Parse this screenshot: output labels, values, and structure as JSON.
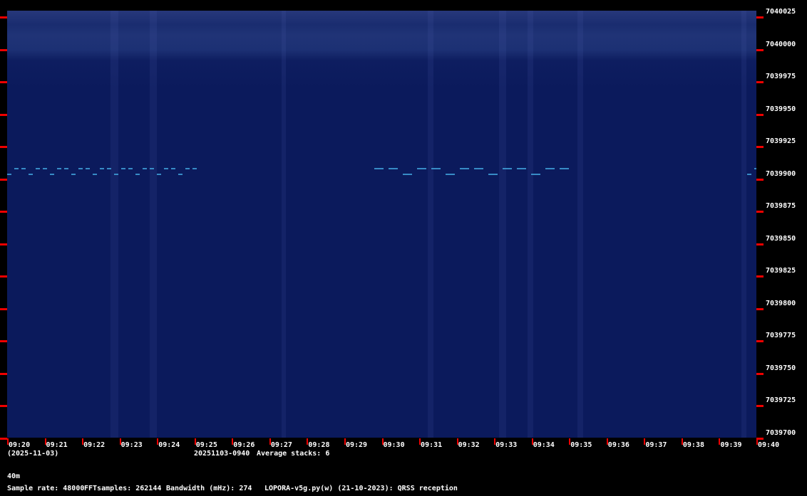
{
  "y_axis": {
    "labels": [
      "7040025",
      "7040000",
      "7039975",
      "7039950",
      "7039925",
      "7039900",
      "7039875",
      "7039850",
      "7039825",
      "7039800",
      "7039775",
      "7039750",
      "7039725",
      "7039700"
    ]
  },
  "x_axis": {
    "labels": [
      "09:20",
      "09:21",
      "09:22",
      "09:23",
      "09:24",
      "09:25",
      "09:26",
      "09:27",
      "09:28",
      "09:29",
      "09:30",
      "09:31",
      "09:32",
      "09:33",
      "09:34",
      "09:35",
      "09:36",
      "09:37",
      "09:38",
      "09:39",
      "09:40"
    ]
  },
  "footer": {
    "date": "(2025-11-03)",
    "file_id": "20251103-0940",
    "average_stacks": "Average stacks: 6",
    "band": "40m",
    "sample_rate": "Sample rate: 48000",
    "fft_samples": "FFTsamples: 262144",
    "bandwidth": "Bandwidth (mHz): 274",
    "program": "LOPORA-v5g.py(w) (21-10-2023): QRSS reception"
  },
  "colors": {
    "background": "#0b1a5c",
    "signal": "#3fa0d8",
    "tick": "#ee0000"
  }
}
